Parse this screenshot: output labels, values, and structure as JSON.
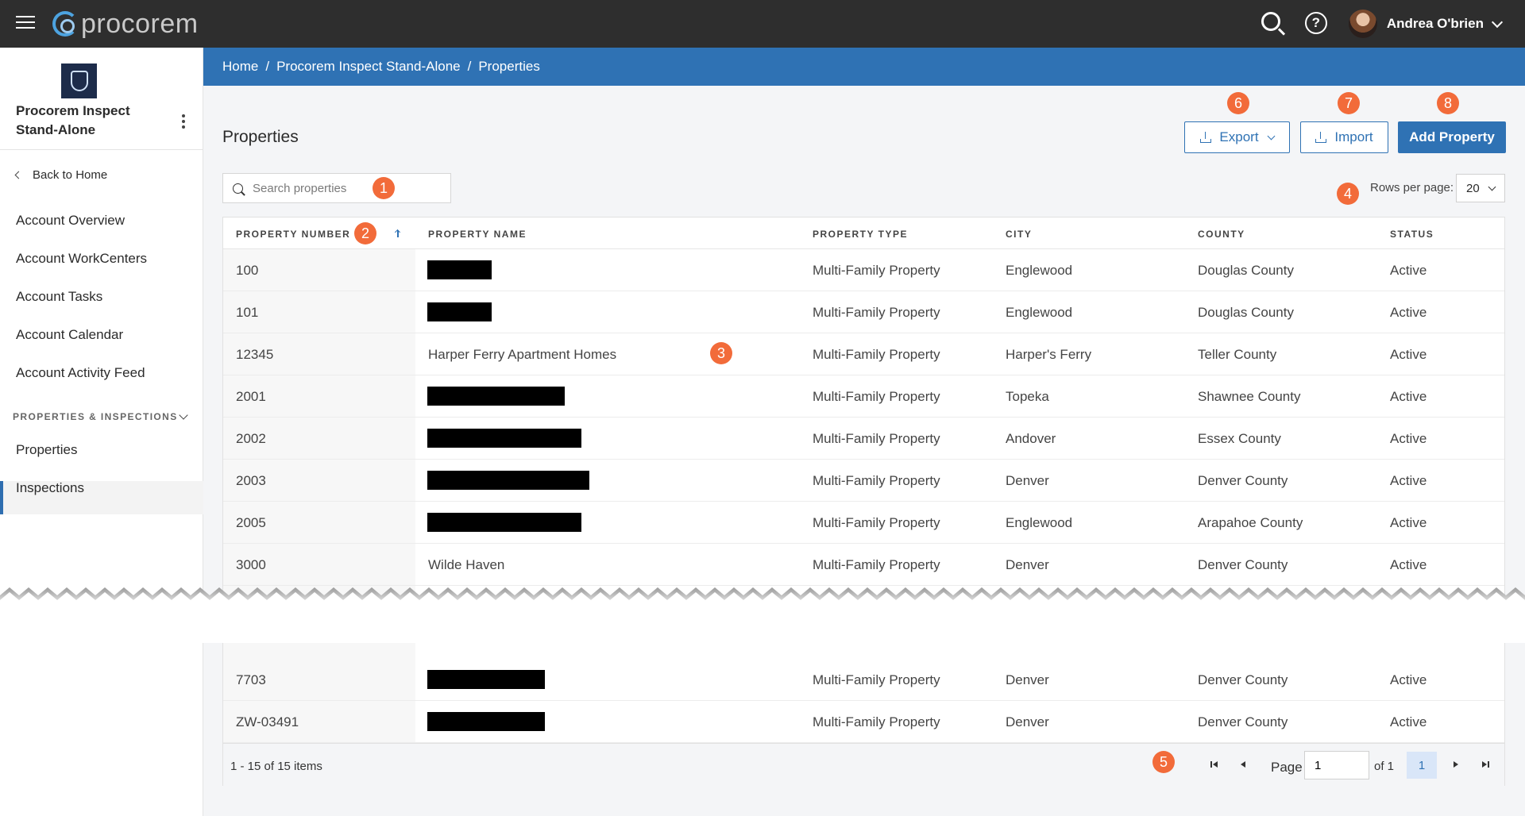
{
  "app": {
    "logo_text": "procorem"
  },
  "topbar": {
    "user_name": "Andrea O'brien"
  },
  "sidebar": {
    "project_name": "Procorem Inspect Stand-Alone",
    "back_label": "Back to Home",
    "items": [
      {
        "label": "Account Overview"
      },
      {
        "label": "Account WorkCenters"
      },
      {
        "label": "Account Tasks"
      },
      {
        "label": "Account Calendar"
      },
      {
        "label": "Account Activity Feed"
      }
    ],
    "section_label": "PROPERTIES & INSPECTIONS",
    "section_items": [
      {
        "label": "Properties",
        "active": true
      },
      {
        "label": "Inspections"
      }
    ]
  },
  "breadcrumb": [
    "Home",
    "Procorem Inspect Stand-Alone",
    "Properties"
  ],
  "page": {
    "title": "Properties",
    "export_label": "Export",
    "import_label": "Import",
    "add_label": "Add Property",
    "search_placeholder": "Search properties",
    "rows_label": "Rows per page:",
    "rows_value": "20"
  },
  "badges": [
    "1",
    "2",
    "3",
    "4",
    "5",
    "6",
    "7",
    "8"
  ],
  "table": {
    "columns": [
      "PROPERTY NUMBER",
      "PROPERTY NAME",
      "PROPERTY TYPE",
      "CITY",
      "COUNTY",
      "STATUS"
    ],
    "rows": [
      {
        "number": "100",
        "name": "",
        "redacted": true,
        "type": "Multi-Family Property",
        "city": "Englewood",
        "county": "Douglas County",
        "status": "Active"
      },
      {
        "number": "101",
        "name": "",
        "redacted": true,
        "type": "Multi-Family Property",
        "city": "Englewood",
        "county": "Douglas County",
        "status": "Active"
      },
      {
        "number": "12345",
        "name": "Harper Ferry Apartment Homes",
        "redacted": false,
        "type": "Multi-Family Property",
        "city": "Harper's Ferry",
        "county": "Teller County",
        "status": "Active"
      },
      {
        "number": "2001",
        "name": "",
        "redacted": true,
        "type": "Multi-Family Property",
        "city": "Topeka",
        "county": "Shawnee County",
        "status": "Active"
      },
      {
        "number": "2002",
        "name": "",
        "redacted": true,
        "type": "Multi-Family Property",
        "city": "Andover",
        "county": "Essex County",
        "status": "Active"
      },
      {
        "number": "2003",
        "name": "",
        "redacted": true,
        "type": "Multi-Family Property",
        "city": "Denver",
        "county": "Denver County",
        "status": "Active"
      },
      {
        "number": "2005",
        "name": "",
        "redacted": true,
        "type": "Multi-Family Property",
        "city": "Englewood",
        "county": "Arapahoe County",
        "status": "Active"
      },
      {
        "number": "3000",
        "name": "Wilde Haven",
        "redacted": false,
        "type": "Multi-Family Property",
        "city": "Denver",
        "county": "Denver County",
        "status": "Active"
      },
      {
        "number": "7703",
        "name": "",
        "redacted": true,
        "type": "Multi-Family Property",
        "city": "Denver",
        "county": "Denver County",
        "status": "Active"
      },
      {
        "number": "ZW-03491",
        "name": "",
        "redacted": true,
        "type": "Multi-Family Property",
        "city": "Denver",
        "county": "Denver County",
        "status": "Active"
      }
    ]
  },
  "pagination": {
    "items_text": "1 - 15 of 15 items",
    "page_label": "Page",
    "page_value": "1",
    "of_label": "of 1",
    "current_page": "1"
  },
  "colors": {
    "topbar": "#2e2e2e",
    "brand_blue": "#2f72b4",
    "badge": "#f26b3a"
  }
}
